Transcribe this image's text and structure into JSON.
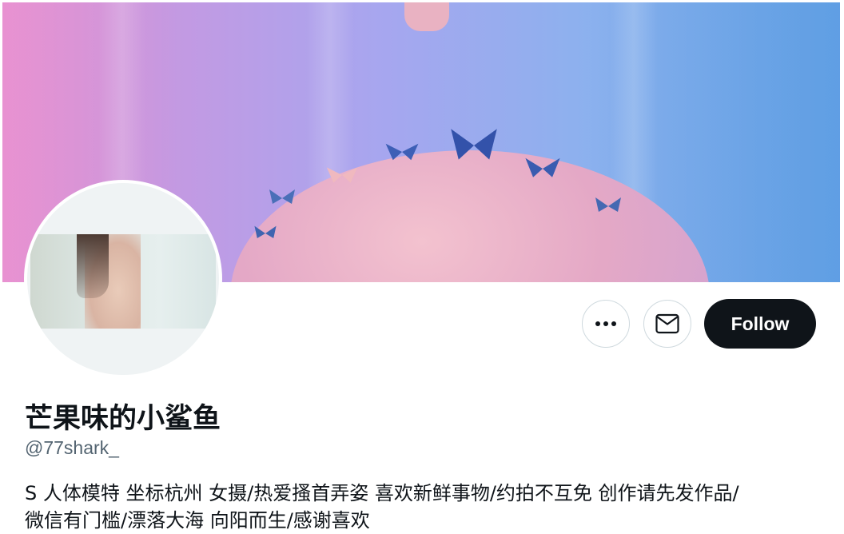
{
  "banner": {
    "icon": "butterfly-icon"
  },
  "actions": {
    "more_icon": "more-dots-icon",
    "message_icon": "envelope-icon",
    "follow_label": "Follow"
  },
  "profile": {
    "display_name": "芒果味的小鲨鱼",
    "handle": "@77shark_",
    "bio_line1": "S 人体模特 坐标杭州 女摄/热爱搔首弄姿 喜欢新鲜事物/约拍不互免 创作请先发作品/",
    "bio_line2": "微信有门槛/漂落大海 向阳而生/感谢喜欢"
  },
  "colors": {
    "follow_bg": "#0f1419",
    "follow_text": "#ffffff",
    "handle_text": "#536471",
    "border": "#cfd9de"
  }
}
